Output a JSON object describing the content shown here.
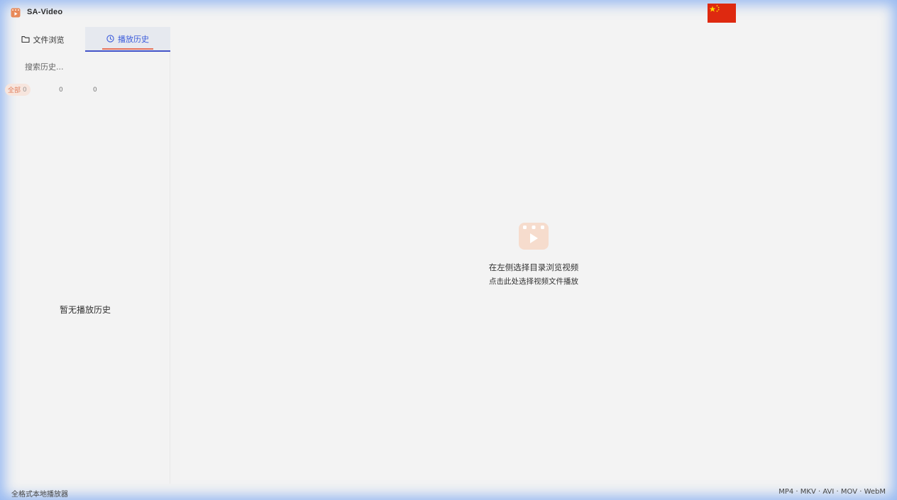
{
  "app": {
    "title": "SA-Video",
    "language_flag": "china-flag-icon",
    "accent_color": "#e7735c",
    "tab_active_color": "#3b5bdb"
  },
  "sidebar": {
    "tabs": [
      {
        "label": "文件浏览",
        "icon": "folder-icon"
      },
      {
        "label": "播放历史",
        "icon": "clock-icon",
        "active": true
      }
    ],
    "search": {
      "placeholder": "搜索历史...",
      "value": ""
    },
    "filters": [
      {
        "label": "全部",
        "count": "0",
        "active": true
      },
      {
        "label": "",
        "count": "0"
      },
      {
        "label": "",
        "count": "0"
      }
    ],
    "empty_text": "暂无播放历史"
  },
  "main": {
    "icon": "video-clapper-icon",
    "line1": "在左侧选择目录浏览视频",
    "line2": "点击此处选择视频文件播放"
  },
  "status": {
    "left": "全格式本地播放器",
    "right": "MP4 · MKV · AVI · MOV · WebM"
  }
}
